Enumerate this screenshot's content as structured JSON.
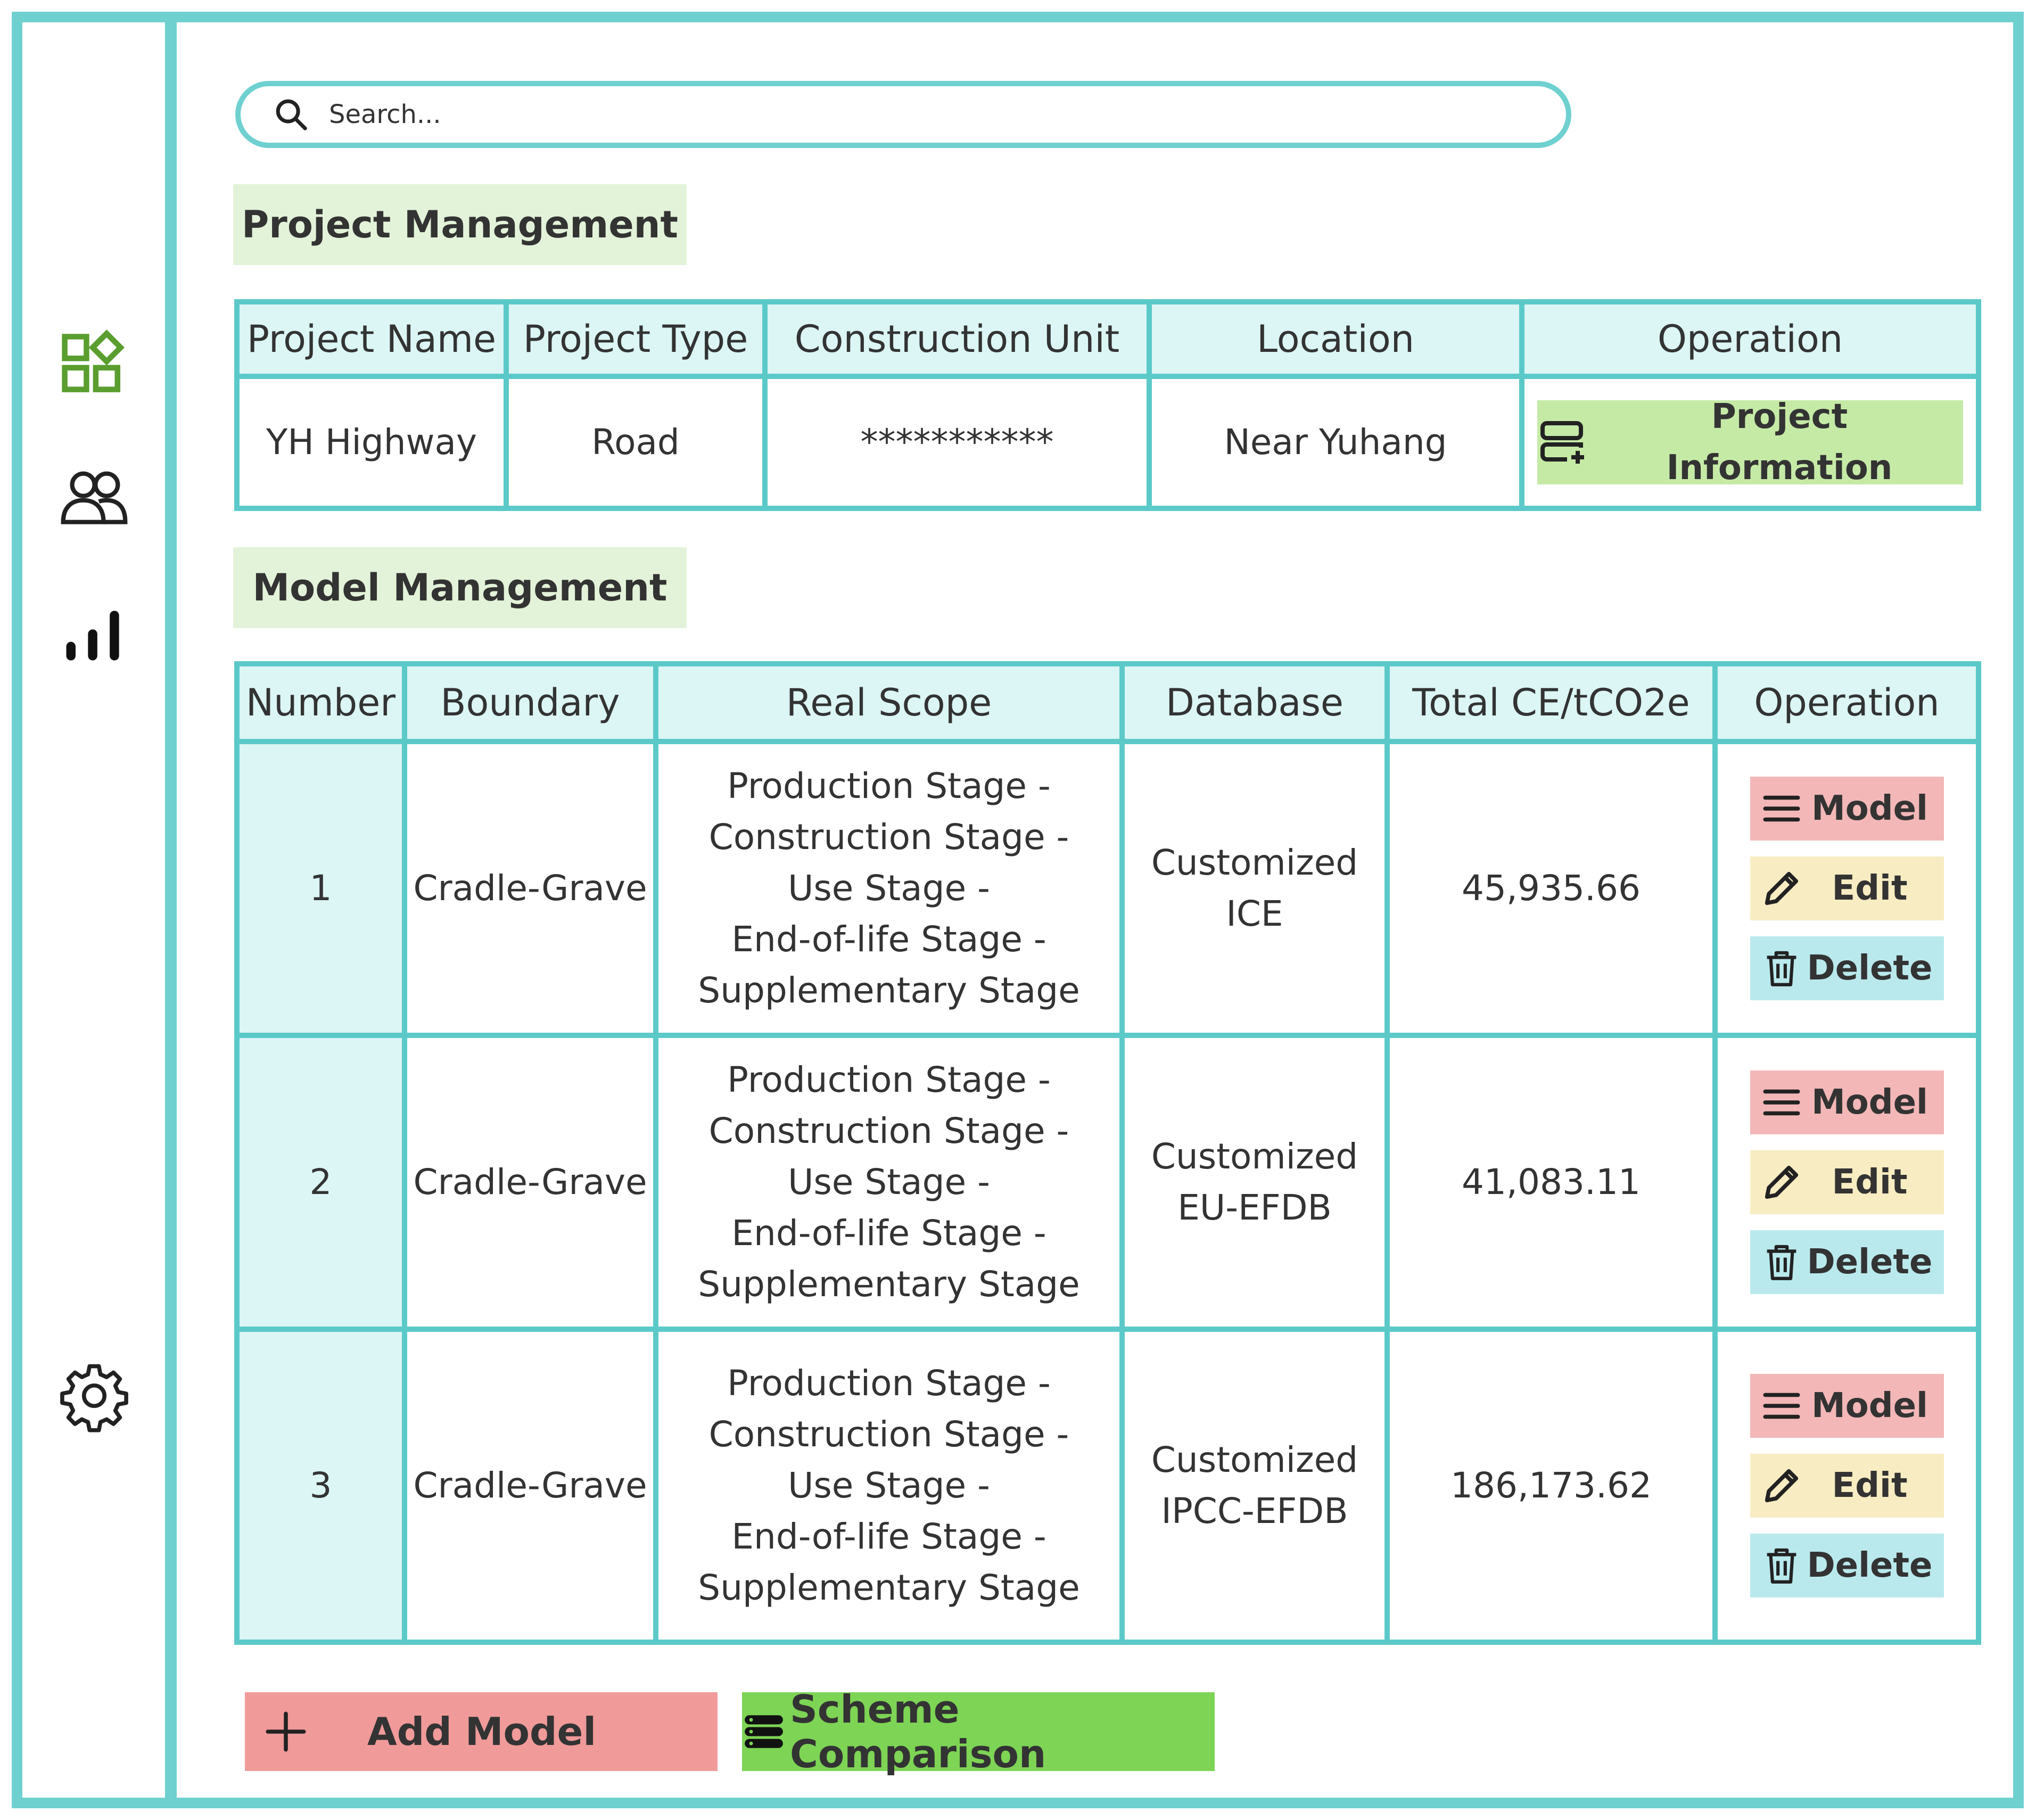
{
  "sidebar": {
    "icons": [
      {
        "name": "dashboard-icon",
        "color": "#5a9e2f"
      },
      {
        "name": "users-icon"
      },
      {
        "name": "chart-bars-icon"
      },
      {
        "name": "settings-gear-icon"
      }
    ]
  },
  "search": {
    "placeholder": "Search..."
  },
  "project_section": {
    "title": "Project Management",
    "columns": [
      "Project Name",
      "Project Type",
      "Construction Unit",
      "Location",
      "Operation"
    ],
    "row": {
      "name": "YH Highway",
      "type": "Road",
      "unit": "***********",
      "location": "Near Yuhang",
      "action_label": "Project Information"
    }
  },
  "model_section": {
    "title": "Model Management",
    "columns": [
      "Number",
      "Boundary",
      "Real Scope",
      "Database",
      "Total CE/tCO2e",
      "Operation"
    ],
    "rows": [
      {
        "number": "1",
        "boundary": "Cradle-Grave",
        "scope": [
          "Production Stage -",
          "Construction Stage -",
          "Use Stage -",
          "End-of-life Stage -",
          "Supplementary Stage"
        ],
        "database": [
          "Customized",
          "ICE"
        ],
        "total": "45,935.66"
      },
      {
        "number": "2",
        "boundary": "Cradle-Grave",
        "scope": [
          "Production Stage -",
          "Construction Stage -",
          "Use Stage -",
          "End-of-life Stage -",
          "Supplementary Stage"
        ],
        "database": [
          "Customized",
          "EU-EFDB"
        ],
        "total": "41,083.11"
      },
      {
        "number": "3",
        "boundary": "Cradle-Grave",
        "scope": [
          "Production Stage -",
          "Construction Stage -",
          "Use Stage -",
          "End-of-life Stage -",
          "Supplementary Stage"
        ],
        "database": [
          "Customized",
          "IPCC-EFDB"
        ],
        "total": "186,173.62"
      }
    ],
    "row_actions": {
      "model": "Model",
      "edit": "Edit",
      "delete": "Delete"
    }
  },
  "footer": {
    "add_model": "Add Model",
    "scheme_comparison": "Scheme Comparison"
  },
  "colors": {
    "accent": "#6fd0d0",
    "header_bg": "#dcf5f5",
    "section_bg": "#e3f3d9",
    "model_btn": "#f3b7b7",
    "edit_btn": "#f8ecc2",
    "delete_btn": "#b9e9ed",
    "add_btn": "#f09a9a",
    "compare_btn": "#7dd455",
    "project_info_btn": "#c5eaa6"
  }
}
